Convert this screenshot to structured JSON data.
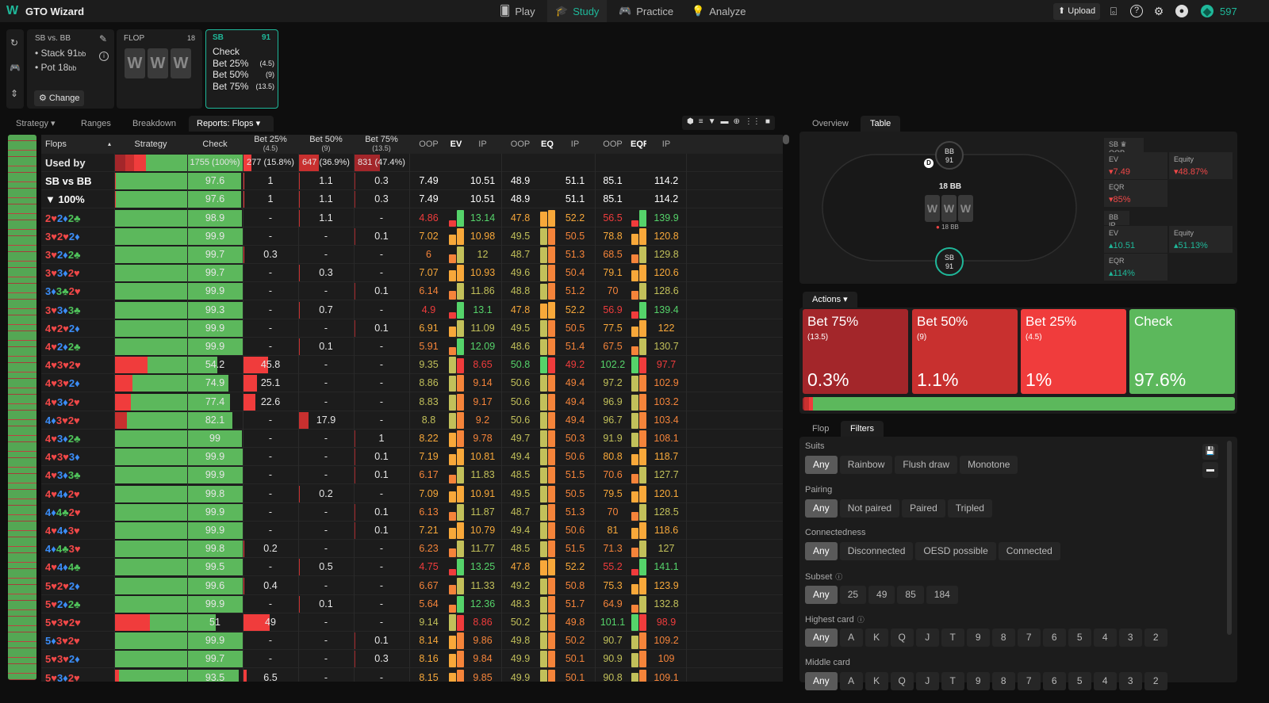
{
  "app": {
    "title": "GTO Wizard",
    "logo": "W"
  },
  "nav": [
    {
      "label": "Play",
      "icon": "cards-icon"
    },
    {
      "label": "Study",
      "icon": "graduation-cap-icon",
      "active": true
    },
    {
      "label": "Practice",
      "icon": "gamepad-icon"
    },
    {
      "label": "Analyze",
      "icon": "lightbulb-icon"
    }
  ],
  "top_right": {
    "upload": "Upload",
    "coins": "597"
  },
  "scenario": {
    "title": "SB vs. BB",
    "stack": "Stack 91",
    "stack_unit": "bb",
    "pot": "Pot 18",
    "pot_unit": "bb",
    "change": "Change"
  },
  "flop_panel": {
    "label": "FLOP",
    "pot": "18",
    "cards": [
      "W",
      "W",
      "W"
    ]
  },
  "sb_panel": {
    "pos": "SB",
    "stack": "91",
    "actions": [
      {
        "label": "Check",
        "size": ""
      },
      {
        "label": "Bet 25%",
        "size": "(4.5)"
      },
      {
        "label": "Bet 50%",
        "size": "(9)"
      },
      {
        "label": "Bet 75%",
        "size": "(13.5)"
      }
    ]
  },
  "tabs": [
    {
      "label": "Strategy",
      "dropdown": true
    },
    {
      "label": "Ranges"
    },
    {
      "label": "Breakdown"
    },
    {
      "label": "Reports: Flops",
      "dropdown": true,
      "active": true
    }
  ],
  "colors": {
    "check": "#5cb85c",
    "bet25": "#f03c3c",
    "bet50": "#c8302f",
    "bet75": "#a3262a",
    "accent": "#1fb89a"
  },
  "table": {
    "headers": {
      "flops": "Flops",
      "strategy": "Strategy",
      "check": "Check",
      "bet25": "Bet 25%",
      "bet25_size": "(4.5)",
      "bet50": "Bet 50%",
      "bet50_size": "(9)",
      "bet75": "Bet 75%",
      "bet75_size": "(13.5)",
      "oop": "OOP",
      "ip": "IP",
      "ev": "EV",
      "eq": "EQ",
      "eqr": "EQR"
    },
    "used_by": {
      "label": "Used by",
      "check": "1755 (100%)",
      "bet25": "277 (15.8%)",
      "bet50": "647 (36.9%)",
      "bet75": "831 (47.4%)",
      "check_pct": 100,
      "bet25_pct": 15.8,
      "bet50_pct": 36.9,
      "bet75_pct": 47.4
    },
    "fields": [
      "flop",
      "check",
      "bet25",
      "bet50",
      "bet75",
      "ev_oop",
      "ev_ip",
      "eq_oop",
      "eq_ip",
      "eqr_oop",
      "eqr_ip"
    ],
    "summary_rows": [
      [
        "SB vs BB",
        97.6,
        1,
        1.1,
        0.3,
        7.49,
        10.51,
        48.9,
        51.1,
        85.1,
        114.2
      ],
      [
        "▼ 100%",
        97.6,
        1,
        1.1,
        0.3,
        7.49,
        10.51,
        48.9,
        51.1,
        85.1,
        114.2
      ]
    ],
    "rows": [
      [
        "2♥2♦2♣",
        98.9,
        null,
        1.1,
        null,
        4.86,
        13.14,
        47.8,
        52.2,
        56.5,
        139.9
      ],
      [
        "3♥2♥2♦",
        99.9,
        null,
        null,
        0.1,
        7.02,
        10.98,
        49.5,
        50.5,
        78.8,
        120.8
      ],
      [
        "3♥2♦2♣",
        99.7,
        0.3,
        null,
        null,
        6,
        12,
        48.7,
        51.3,
        68.5,
        129.8
      ],
      [
        "3♥3♦2♥",
        99.7,
        null,
        0.3,
        null,
        7.07,
        10.93,
        49.6,
        50.4,
        79.1,
        120.6
      ],
      [
        "3♦3♣2♥",
        99.9,
        null,
        null,
        0.1,
        6.14,
        11.86,
        48.8,
        51.2,
        70,
        128.6
      ],
      [
        "3♥3♦3♣",
        99.3,
        null,
        0.7,
        null,
        4.9,
        13.1,
        47.8,
        52.2,
        56.9,
        139.4
      ],
      [
        "4♥2♥2♦",
        99.9,
        null,
        null,
        0.1,
        6.91,
        11.09,
        49.5,
        50.5,
        77.5,
        122
      ],
      [
        "4♥2♦2♣",
        99.9,
        null,
        0.1,
        null,
        5.91,
        12.09,
        48.6,
        51.4,
        67.5,
        130.7
      ],
      [
        "4♥3♥2♥",
        54.2,
        45.8,
        null,
        null,
        9.35,
        8.65,
        50.8,
        49.2,
        102.2,
        97.7
      ],
      [
        "4♥3♥2♦",
        74.9,
        25.1,
        null,
        null,
        8.86,
        9.14,
        50.6,
        49.4,
        97.2,
        102.9
      ],
      [
        "4♥3♦2♥",
        77.4,
        22.6,
        null,
        null,
        8.83,
        9.17,
        50.6,
        49.4,
        96.9,
        103.2
      ],
      [
        "4♦3♥2♥",
        82.1,
        null,
        17.9,
        null,
        8.8,
        9.2,
        50.6,
        49.4,
        96.7,
        103.4
      ],
      [
        "4♥3♦2♣",
        99,
        null,
        null,
        1,
        8.22,
        9.78,
        49.7,
        50.3,
        91.9,
        108.1
      ],
      [
        "4♥3♥3♦",
        99.9,
        null,
        null,
        0.1,
        7.19,
        10.81,
        49.4,
        50.6,
        80.8,
        118.7
      ],
      [
        "4♥3♦3♣",
        99.9,
        null,
        null,
        0.1,
        6.17,
        11.83,
        48.5,
        51.5,
        70.6,
        127.7
      ],
      [
        "4♥4♦2♥",
        99.8,
        null,
        0.2,
        null,
        7.09,
        10.91,
        49.5,
        50.5,
        79.5,
        120.1
      ],
      [
        "4♦4♣2♥",
        99.9,
        null,
        null,
        0.1,
        6.13,
        11.87,
        48.7,
        51.3,
        70,
        128.5
      ],
      [
        "4♥4♦3♥",
        99.9,
        null,
        null,
        0.1,
        7.21,
        10.79,
        49.4,
        50.6,
        81,
        118.6
      ],
      [
        "4♦4♣3♥",
        99.8,
        0.2,
        null,
        null,
        6.23,
        11.77,
        48.5,
        51.5,
        71.3,
        127
      ],
      [
        "4♥4♦4♣",
        99.5,
        null,
        0.5,
        null,
        4.75,
        13.25,
        47.8,
        52.2,
        55.2,
        141.1
      ],
      [
        "5♥2♥2♦",
        99.6,
        0.4,
        null,
        null,
        6.67,
        11.33,
        49.2,
        50.8,
        75.3,
        123.9
      ],
      [
        "5♥2♦2♣",
        99.9,
        null,
        0.1,
        null,
        5.64,
        12.36,
        48.3,
        51.7,
        64.9,
        132.8
      ],
      [
        "5♥3♥2♥",
        51,
        49,
        null,
        null,
        9.14,
        8.86,
        50.2,
        49.8,
        101.1,
        98.9
      ],
      [
        "5♦3♥2♥",
        99.9,
        null,
        null,
        0.1,
        8.14,
        9.86,
        49.8,
        50.2,
        90.7,
        109.2
      ],
      [
        "5♥3♥2♦",
        99.7,
        null,
        null,
        0.3,
        8.16,
        9.84,
        49.9,
        50.1,
        90.9,
        109
      ],
      [
        "5♥3♦2♥",
        93.5,
        6.5,
        null,
        null,
        8.15,
        9.85,
        49.9,
        50.1,
        90.8,
        109.1
      ]
    ]
  },
  "right": {
    "tabs": [
      {
        "label": "Overview"
      },
      {
        "label": "Table",
        "active": true
      }
    ],
    "poker_table": {
      "bb_seat": "BB",
      "bb_stack": "91",
      "sb_seat": "SB",
      "sb_stack": "91",
      "dealer": "D",
      "pot": "18 BB",
      "bet_pot": "18 BB",
      "cards": [
        "W",
        "W",
        "W"
      ]
    },
    "sb_stats": {
      "header": "SB",
      "role": "OOP",
      "ev_label": "EV",
      "ev": "7.49",
      "eq_label": "Equity",
      "eq": "48.87%",
      "eqr_label": "EQR",
      "eqr": "85%"
    },
    "bb_stats": {
      "header": "BB",
      "role": "IP",
      "ev_label": "EV",
      "ev": "10.51",
      "eq_label": "Equity",
      "eq": "51.13%",
      "eqr_label": "EQR",
      "eqr": "114%"
    },
    "actions_tab": "Actions",
    "actions": [
      {
        "label": "Bet 75%",
        "size": "(13.5)",
        "pct": "0.3%",
        "value": 0.3,
        "color": "#a3262a"
      },
      {
        "label": "Bet 50%",
        "size": "(9)",
        "pct": "1.1%",
        "value": 1.1,
        "color": "#c8302f"
      },
      {
        "label": "Bet 25%",
        "size": "(4.5)",
        "pct": "1%",
        "value": 1,
        "color": "#f03c3c"
      },
      {
        "label": "Check",
        "size": "",
        "pct": "97.6%",
        "value": 97.6,
        "color": "#5cb85c"
      }
    ],
    "bottom_tabs": [
      {
        "label": "Flop"
      },
      {
        "label": "Filters",
        "active": true
      }
    ],
    "filters": [
      {
        "label": "Suits",
        "options": [
          "Any",
          "Rainbow",
          "Flush draw",
          "Monotone"
        ]
      },
      {
        "label": "Pairing",
        "options": [
          "Any",
          "Not paired",
          "Paired",
          "Tripled"
        ]
      },
      {
        "label": "Connectedness",
        "options": [
          "Any",
          "Disconnected",
          "OESD possible",
          "Connected"
        ]
      },
      {
        "label": "Subset",
        "help": true,
        "options": [
          "Any",
          "25",
          "49",
          "85",
          "184"
        ]
      },
      {
        "label": "Highest card",
        "help": true,
        "options": [
          "Any",
          "A",
          "K",
          "Q",
          "J",
          "T",
          "9",
          "8",
          "7",
          "6",
          "5",
          "4",
          "3",
          "2"
        ]
      },
      {
        "label": "Middle card",
        "options": [
          "Any",
          "A",
          "K",
          "Q",
          "J",
          "T",
          "9",
          "8",
          "7",
          "6",
          "5",
          "4",
          "3",
          "2"
        ]
      }
    ],
    "selected_filter": "Any"
  }
}
